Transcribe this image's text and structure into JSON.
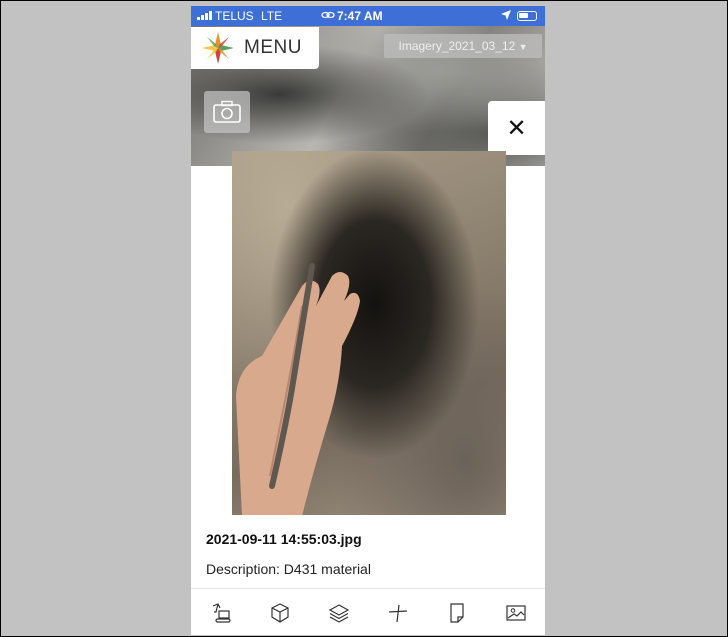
{
  "status_bar": {
    "carrier": "TELUS",
    "network": "LTE",
    "time": "7:47 AM"
  },
  "header": {
    "menu_label": "MENU",
    "imagery_label": "Imagery_2021_03_12"
  },
  "photo_viewer": {
    "close_glyph": "✕",
    "filename": "2021-09-11 14:55:03.jpg",
    "description": "Description: D431 material"
  },
  "icons": {
    "logo": "compass-star-logo-icon",
    "camera": "camera-icon",
    "close": "close-icon",
    "toolbar": [
      "excavator-icon",
      "cube-icon",
      "layers-icon",
      "measure-icon",
      "note-icon",
      "image-icon"
    ]
  },
  "colors": {
    "status_bar": "#3d6fd6",
    "accent_logo": [
      "#e8922e",
      "#5ba35a",
      "#c9453a",
      "#f3c84b"
    ]
  }
}
